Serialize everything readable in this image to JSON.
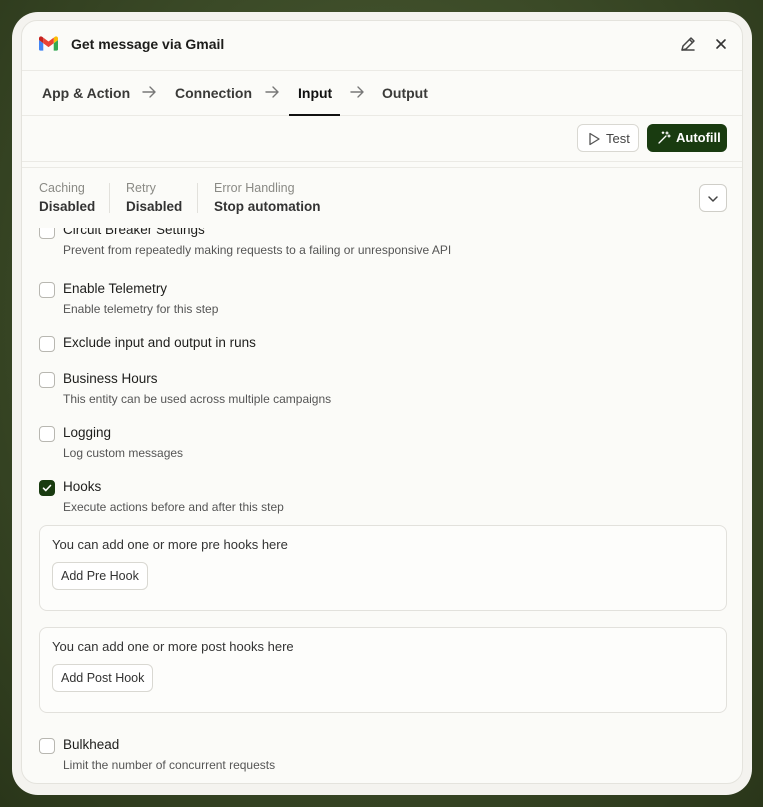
{
  "header": {
    "title": "Get message via Gmail"
  },
  "tabs": [
    {
      "label": "App & Action"
    },
    {
      "label": "Connection"
    },
    {
      "label": "Input"
    },
    {
      "label": "Output"
    }
  ],
  "toolbar": {
    "test_label": "Test",
    "autofill_label": "Autofill"
  },
  "summary": [
    {
      "label": "Caching",
      "value": "Disabled"
    },
    {
      "label": "Retry",
      "value": "Disabled"
    },
    {
      "label": "Error Handling",
      "value": "Stop automation"
    }
  ],
  "settings": [
    {
      "title": "Circuit Breaker Settings",
      "description": "Prevent from repeatedly making requests to a failing or unresponsive API",
      "checked": false
    },
    {
      "title": "Enable Telemetry",
      "description": "Enable telemetry for this step",
      "checked": false
    },
    {
      "title": "Exclude input and output in runs",
      "description": "",
      "checked": false
    },
    {
      "title": "Business Hours",
      "description": "This entity can be used across multiple campaigns",
      "checked": false
    },
    {
      "title": "Logging",
      "description": "Log custom messages",
      "checked": false
    },
    {
      "title": "Hooks",
      "description": "Execute actions before and after this step",
      "checked": true
    },
    {
      "title": "Bulkhead",
      "description": "Limit the number of concurrent requests",
      "checked": false
    }
  ],
  "hooks": {
    "pre_text": "You can add one or more pre hooks here",
    "pre_button": "Add Pre Hook",
    "post_text": "You can add one or more post hooks here",
    "post_button": "Add Post Hook"
  },
  "colors": {
    "accent": "#193b10",
    "background": "#3b4a27",
    "panel": "#fbfbf8"
  },
  "icons": [
    "gmail-logo",
    "pencil-icon",
    "close-icon",
    "arrow-right-icon",
    "play-icon",
    "magic-wand-icon",
    "chevron-down-icon",
    "checkmark-icon"
  ]
}
